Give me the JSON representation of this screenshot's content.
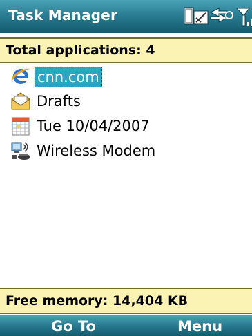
{
  "title_bar": {
    "title": "Task Manager",
    "status_icons": [
      "keyboard-input-icon",
      "data-connection-icon",
      "signal-strength-icon"
    ]
  },
  "header": {
    "total_label": "Total applications: 4"
  },
  "apps": [
    {
      "label": "cnn.com",
      "icon": "internet-explorer-icon",
      "selected": true
    },
    {
      "label": "Drafts",
      "icon": "envelope-icon",
      "selected": false
    },
    {
      "label": "Tue 10/04/2007",
      "icon": "calendar-icon",
      "selected": false
    },
    {
      "label": "Wireless Modem",
      "icon": "wireless-modem-icon",
      "selected": false
    }
  ],
  "footer": {
    "memory_label": "Free memory: 14,404 KB"
  },
  "softkeys": {
    "left": "Go To",
    "right": "Menu"
  },
  "colors": {
    "title_bar": "#2a7d93",
    "strip_background": "#fbf3b4",
    "selection": "#2aa6c1"
  }
}
